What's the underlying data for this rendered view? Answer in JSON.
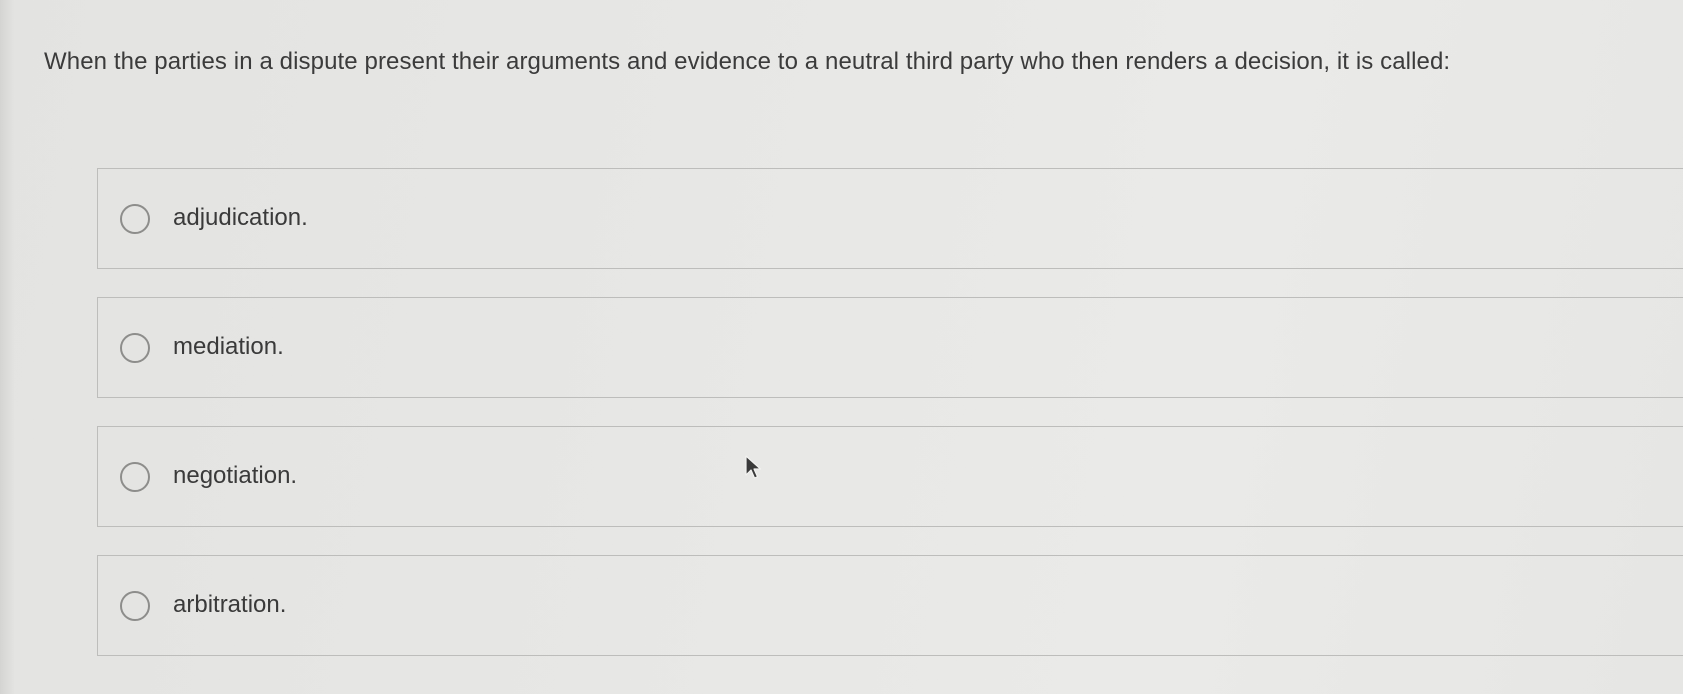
{
  "question": {
    "text": "When the parties in a dispute present their arguments and evidence to a neutral third party who then renders a decision, it is called:"
  },
  "options": [
    {
      "label": "adjudication."
    },
    {
      "label": "mediation."
    },
    {
      "label": "negotiation."
    },
    {
      "label": "arbitration."
    }
  ],
  "icons": {
    "radio": "radio-button-unselected-icon",
    "cursor": "mouse-pointer-icon"
  }
}
